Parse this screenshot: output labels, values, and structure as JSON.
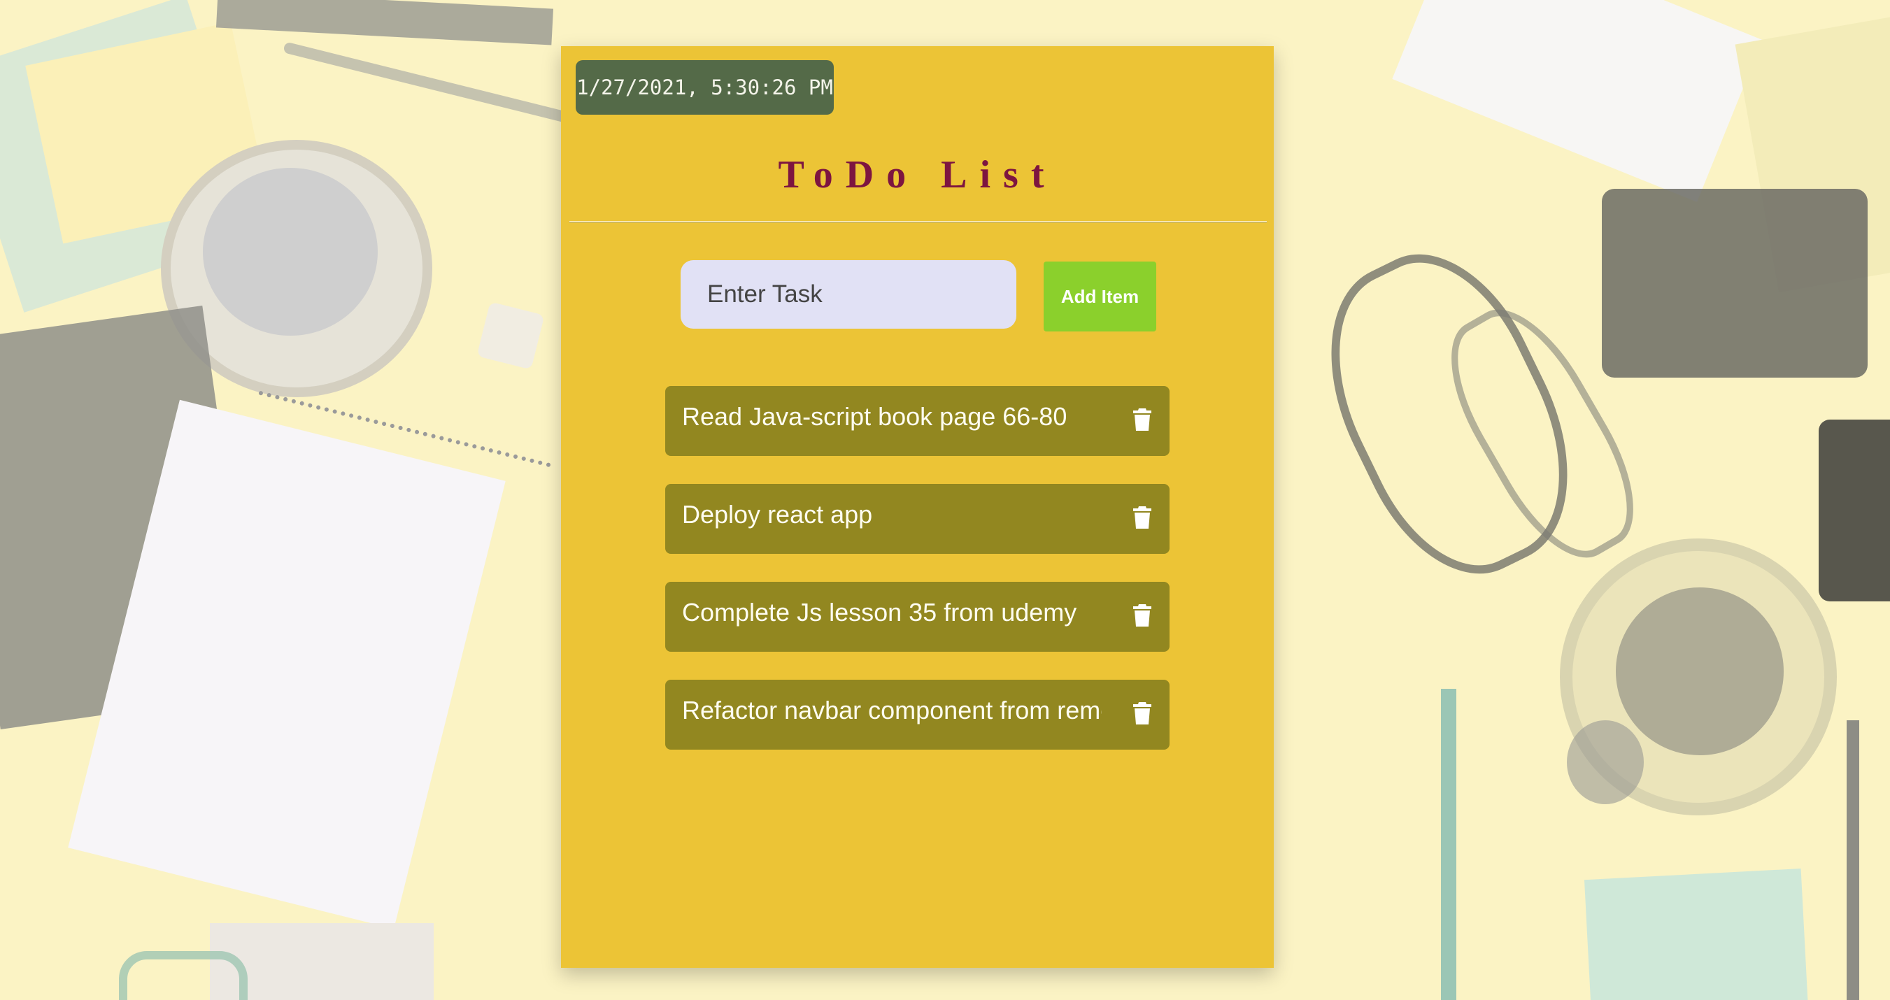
{
  "clock": {
    "datetime": "1/27/2021, 5:30:26 PM"
  },
  "header": {
    "title": "ToDo List"
  },
  "form": {
    "input_placeholder": "Enter Task",
    "add_button_label": "Add Item"
  },
  "todos": [
    {
      "text": "Read Java-script book page 66-80",
      "icon": "trash-icon"
    },
    {
      "text": "Deploy react app",
      "icon": "trash-icon"
    },
    {
      "text": "Complete Js lesson 35 from udemy",
      "icon": "trash-icon"
    },
    {
      "text": "Refactor navbar component from remote",
      "icon": "trash-icon"
    }
  ],
  "colors": {
    "card": "#ecc436",
    "clock_bg": "#546a48",
    "title": "#7d1540",
    "item_bg": "#928720",
    "add_button": "#8bd02c",
    "input_bg": "#e1e1f5"
  }
}
